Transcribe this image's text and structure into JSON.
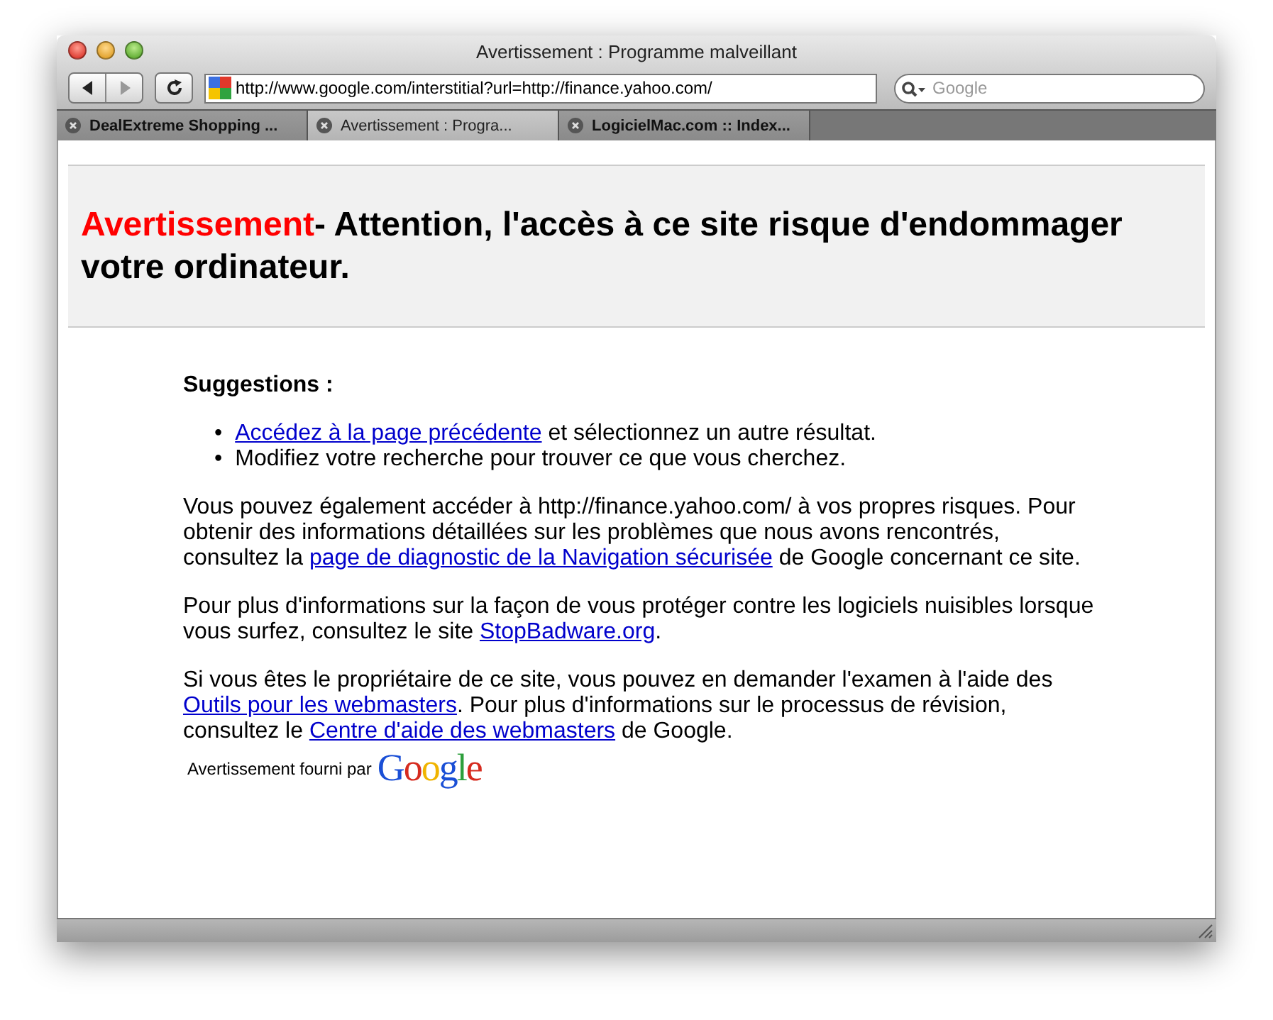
{
  "window": {
    "title": "Avertissement : Programme malveillant"
  },
  "toolbar": {
    "address": "http://www.google.com/interstitial?url=http://finance.yahoo.com/",
    "search": {
      "placeholder": "Google"
    }
  },
  "tabs": [
    {
      "label": "DealExtreme Shopping ...",
      "selected": false
    },
    {
      "label": "Avertissement : Progra...",
      "selected": true
    },
    {
      "label": "LogicielMac.com :: Index...",
      "selected": false
    }
  ],
  "page": {
    "heading_warning": "Avertissement",
    "heading_rest": "- Attention, l'accès à ce site risque d'endommager votre ordinateur.",
    "suggestions_title": "Suggestions :",
    "suggestions": [
      {
        "marker": "•",
        "link": "Accédez à la page précédente",
        "text": " et sélectionnez un autre résultat."
      },
      {
        "marker": "•",
        "text": "Modifiez votre recherche pour trouver ce que vous cherchez."
      }
    ],
    "paragraphs": [
      [
        {
          "text": "Vous pouvez également accéder à http://finance.yahoo.com/ à vos propres risques. Pour obtenir des informations détaillées sur les problèmes que nous avons rencontrés, consultez la "
        },
        {
          "link": "page de diagnostic de la Navigation sécurisée"
        },
        {
          "text": " de Google concernant ce site."
        }
      ],
      [
        {
          "text": "Pour plus d'informations sur la façon de vous protéger contre les logiciels nuisibles lorsque vous surfez, consultez le site "
        },
        {
          "link": "StopBadware.org"
        },
        {
          "text": "."
        }
      ],
      [
        {
          "text": "Si vous êtes le propriétaire de ce site, vous pouvez en demander l'examen à l'aide des "
        },
        {
          "link": "Outils pour les webmasters"
        },
        {
          "text": ". Pour plus d'informations sur le processus de révision, consultez le "
        },
        {
          "link": "Centre d'aide des webmasters"
        },
        {
          "text": " de Google."
        }
      ]
    ],
    "provided_by": "Avertissement fourni par",
    "logo": "Google"
  }
}
